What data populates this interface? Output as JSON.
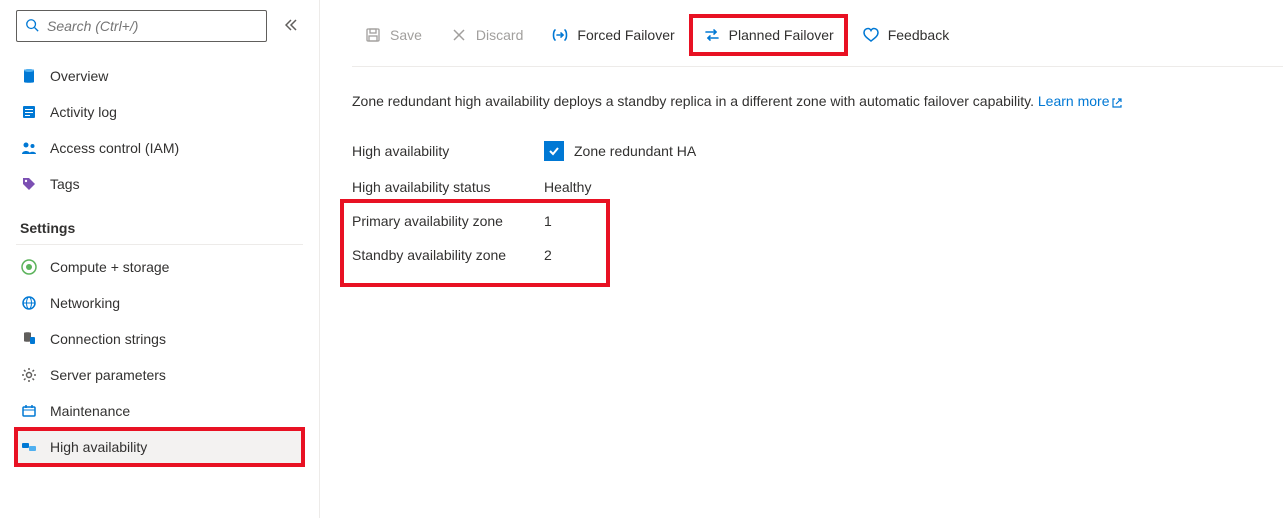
{
  "search": {
    "placeholder": "Search (Ctrl+/)"
  },
  "sidebar": {
    "items": [
      {
        "label": "Overview"
      },
      {
        "label": "Activity log"
      },
      {
        "label": "Access control (IAM)"
      },
      {
        "label": "Tags"
      }
    ],
    "settings_header": "Settings",
    "settings": [
      {
        "label": "Compute + storage"
      },
      {
        "label": "Networking"
      },
      {
        "label": "Connection strings"
      },
      {
        "label": "Server parameters"
      },
      {
        "label": "Maintenance"
      },
      {
        "label": "High availability"
      }
    ]
  },
  "toolbar": {
    "save": "Save",
    "discard": "Discard",
    "forced_failover": "Forced Failover",
    "planned_failover": "Planned Failover",
    "feedback": "Feedback"
  },
  "content": {
    "description": "Zone redundant high availability deploys a standby replica in a different zone with automatic failover capability. ",
    "learn_more": "Learn more",
    "ha_label": "High availability",
    "ha_checkbox_label": "Zone redundant HA",
    "ha_status_label": "High availability status",
    "ha_status_value": "Healthy",
    "primary_zone_label": "Primary availability zone",
    "primary_zone_value": "1",
    "standby_zone_label": "Standby availability zone",
    "standby_zone_value": "2"
  }
}
